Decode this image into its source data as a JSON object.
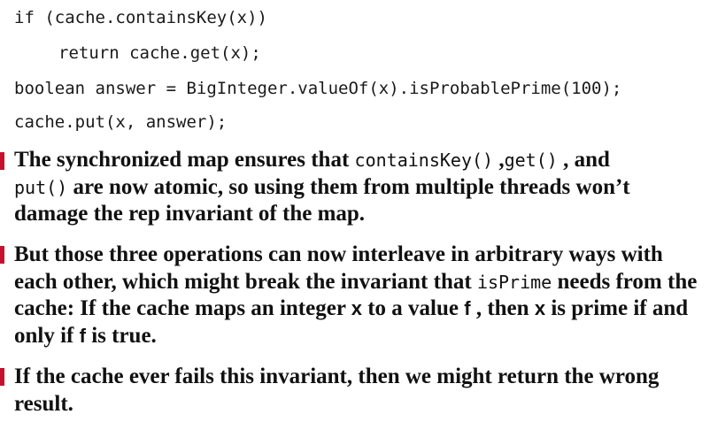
{
  "code_lines": [
    "if (cache.containsKey(x))",
    "return cache.get(x);",
    "boolean answer = BigInteger.valueOf(x).isProbablePrime(100);",
    "cache.put(x, answer);"
  ],
  "bullets": [
    {
      "t1": "The synchronized map ensures that ",
      "c1": "containsKey()",
      "t2": " ,",
      "c2": "get()",
      "t3": " , and",
      "c3": "put()",
      "t4": " are now atomic, so using them from multiple threads won’t damage the rep invariant of the map."
    },
    {
      "t1": "But those three operations can now interleave in arbitrary ways with each other, which might break the invariant that ",
      "c1": "isPrime",
      "t2": " needs from the cache: If the cache maps an integer ",
      "v1": "x",
      "t3": " to a value ",
      "v2": "f",
      "t4": " , then ",
      "v3": "x",
      "t5": " is prime if and only if ",
      "v4": "f",
      "t6": " is true."
    },
    {
      "t1": "If the cache ever fails this invariant, then we might return the wrong result."
    }
  ]
}
